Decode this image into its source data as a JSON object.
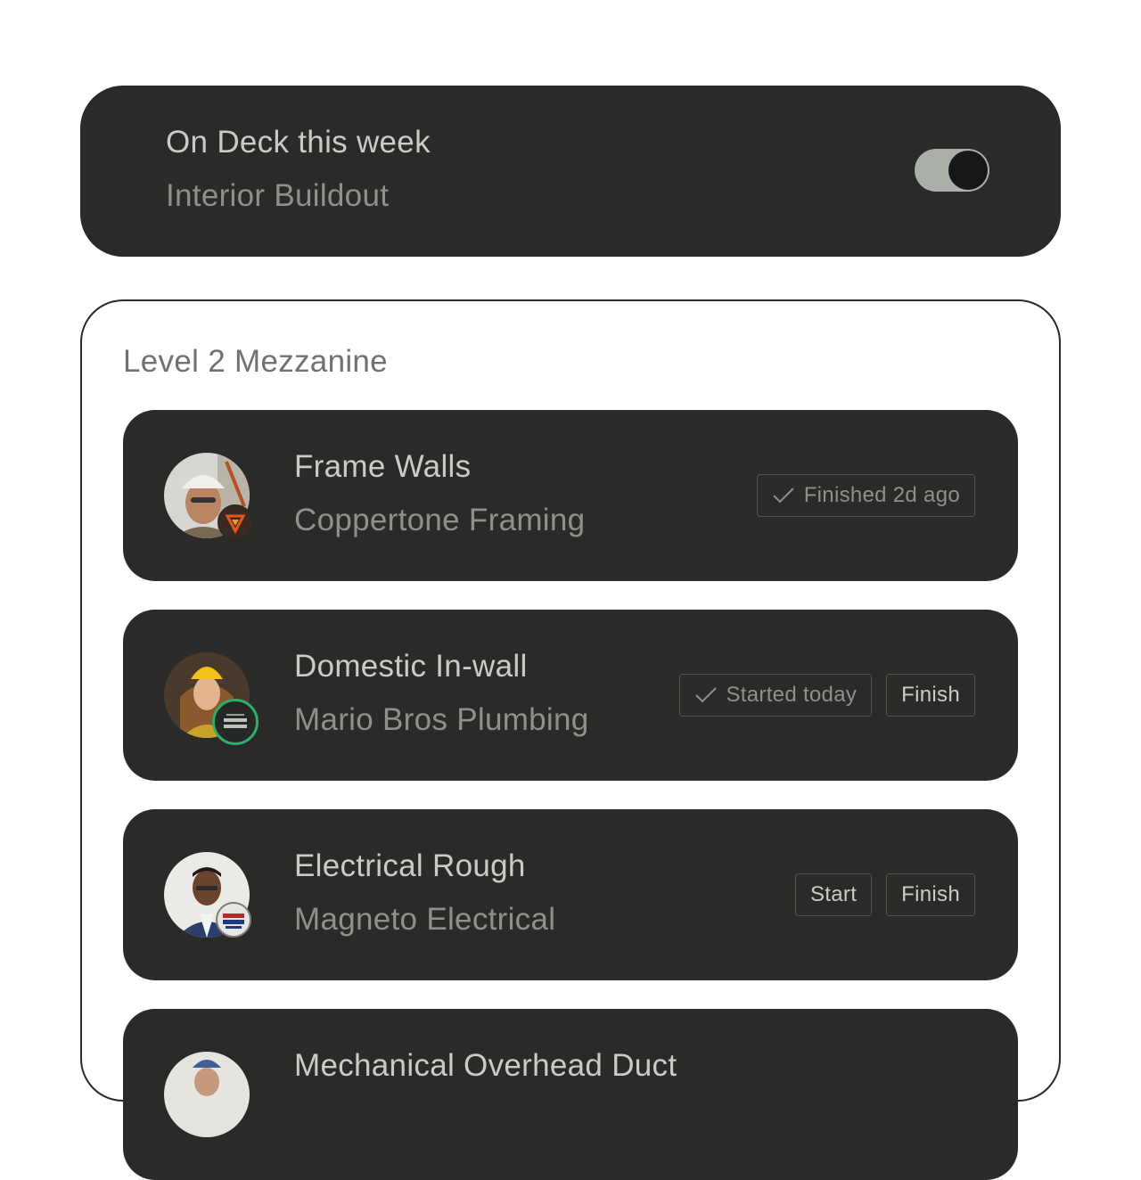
{
  "on_deck": {
    "title": "On Deck this week",
    "subtitle": "Interior Buildout",
    "toggle_on": true
  },
  "section": {
    "heading": "Level 2 Mezzanine",
    "tasks": [
      {
        "name": "Frame Walls",
        "company": "Coppertone Framing",
        "status": "Finished 2d ago",
        "buttons": []
      },
      {
        "name": "Domestic In-wall",
        "company": "Mario Bros Plumbing",
        "status": "Started today",
        "buttons": [
          "Finish"
        ]
      },
      {
        "name": "Electrical Rough",
        "company": "Magneto Electrical",
        "status": "",
        "buttons": [
          "Start",
          "Finish"
        ]
      },
      {
        "name": "Mechanical Overhead Duct",
        "company": "",
        "status": "",
        "buttons": []
      }
    ]
  },
  "colors": {
    "card_bg": "#2a2b29",
    "toggle_track": "#aab0a8",
    "plumbing_ring": "#2fae6b"
  },
  "icons": [
    "check-icon",
    "toggle-switch"
  ]
}
